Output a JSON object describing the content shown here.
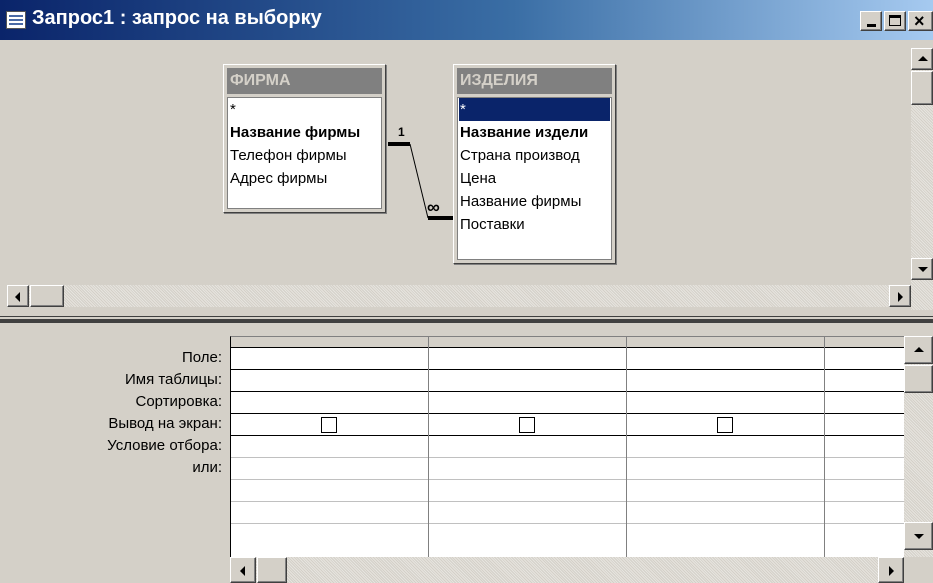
{
  "window": {
    "title": "Запрос1 : запрос на выборку"
  },
  "tables": [
    {
      "name": "ФИРМА",
      "fields": [
        "*",
        "Название фирмы",
        "Телефон фирмы",
        "Адрес фирмы"
      ],
      "key_field_index": 1
    },
    {
      "name": "ИЗДЕЛИЯ",
      "fields": [
        "*",
        "Название издели",
        "Страна производ",
        "Цена",
        "Название фирмы",
        "Поставки"
      ],
      "key_field_index": 1,
      "selected_field_index": 0
    }
  ],
  "relationship": {
    "from_label": "1",
    "to_label": "∞"
  },
  "design_grid": {
    "row_labels": [
      "Поле:",
      "Имя таблицы:",
      "Сортировка:",
      "Вывод на экран:",
      "Условие отбора:",
      "или:"
    ],
    "columns": [
      {
        "field": "",
        "table": "",
        "sort": "",
        "show": false,
        "criteria": "",
        "or": ""
      },
      {
        "field": "",
        "table": "",
        "sort": "",
        "show": false,
        "criteria": "",
        "or": ""
      },
      {
        "field": "",
        "table": "",
        "sort": "",
        "show": false,
        "criteria": "",
        "or": ""
      },
      {
        "field": "",
        "table": "",
        "sort": "",
        "show": null,
        "criteria": "",
        "or": ""
      }
    ]
  },
  "colors": {
    "titlebar_start": "#0a246a",
    "titlebar_end": "#a6caf0",
    "face": "#d4d0c8",
    "selection": "#0a246a"
  }
}
